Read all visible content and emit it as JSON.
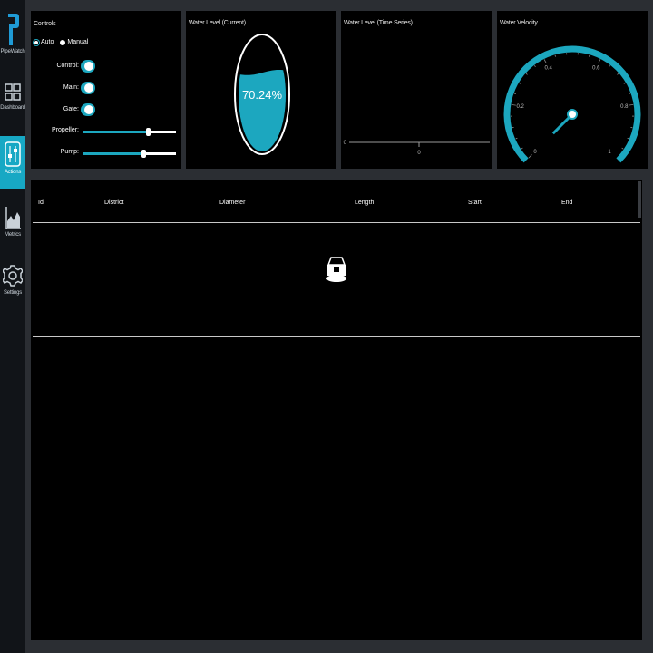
{
  "app": {
    "name": "PipeWatch"
  },
  "nav": [
    {
      "label": "Dashboard",
      "icon": "grid-icon",
      "active": false
    },
    {
      "label": "Actions",
      "icon": "sliders-icon",
      "active": true
    },
    {
      "label": "Metrics",
      "icon": "area-chart-icon",
      "active": false
    },
    {
      "label": "Settings",
      "icon": "gear-icon",
      "active": false
    }
  ],
  "controls": {
    "title": "Controls",
    "mode": {
      "options": [
        "Auto",
        "Manual"
      ],
      "selected": "Auto"
    },
    "toggles": [
      {
        "label": "Control:",
        "on": true
      },
      {
        "label": "Main:",
        "on": true
      },
      {
        "label": "Gate:",
        "on": true
      }
    ],
    "sliders": [
      {
        "label": "Propeller:",
        "value": 0.7
      },
      {
        "label": "Pump:",
        "value": 0.65
      }
    ]
  },
  "water_level_current": {
    "title": "Water Level (Current)",
    "value_text": "70.24%",
    "fraction": 0.7024
  },
  "water_level_series": {
    "title": "Water Level (Time Series)",
    "y_tick": "0",
    "x_tick": "0"
  },
  "water_velocity": {
    "title": "Water Velocity",
    "ticks": [
      "0",
      "0.2",
      "0.4",
      "0.6",
      "0.8",
      "1"
    ],
    "value": 0.0
  },
  "table": {
    "columns": [
      "Id",
      "District",
      "Diameter",
      "Length",
      "Start",
      "End"
    ],
    "rows": []
  },
  "colors": {
    "accent": "#1ca7bf",
    "panel": "#000000",
    "background": "#2b2e33",
    "sidebar": "#111418"
  }
}
